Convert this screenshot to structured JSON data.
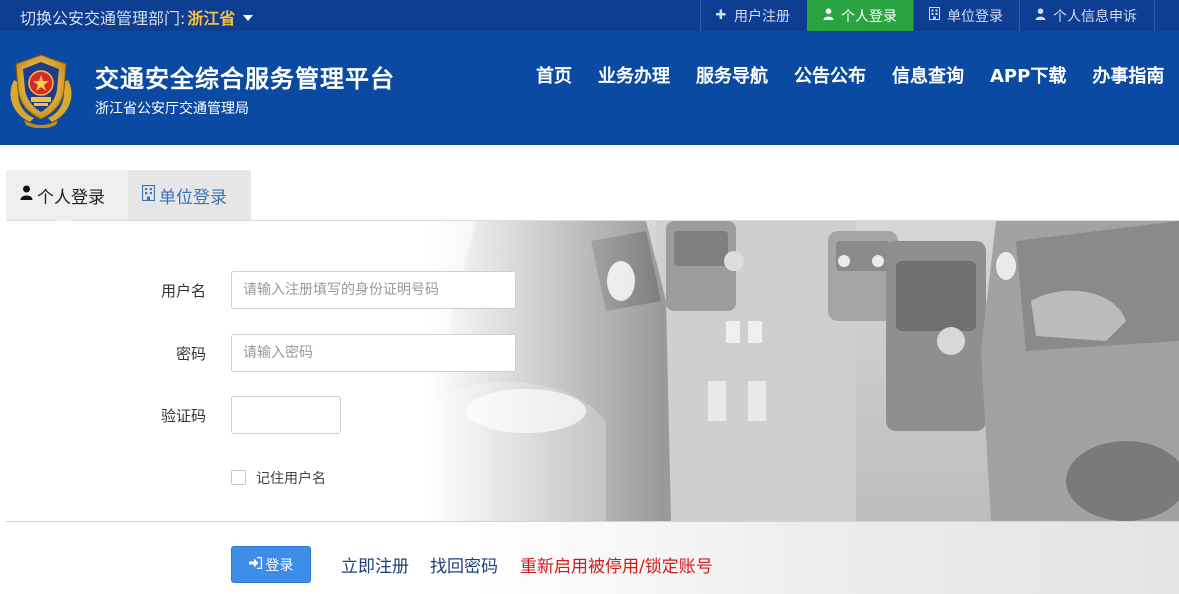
{
  "topbar": {
    "switch_label": "切换公安交通管理部门:",
    "province": "浙江省",
    "links": [
      {
        "icon": "plus-icon",
        "label": "用户注册",
        "active": false
      },
      {
        "icon": "user-icon",
        "label": "个人登录",
        "active": true
      },
      {
        "icon": "building-icon",
        "label": "单位登录",
        "active": false
      },
      {
        "icon": "user-icon",
        "label": "个人信息申诉",
        "active": false
      }
    ]
  },
  "header": {
    "title": "交通安全综合服务管理平台",
    "subtitle": "浙江省公安厅交通管理局",
    "emblem": "police-emblem-icon",
    "nav": [
      "首页",
      "业务办理",
      "服务导航",
      "公告公布",
      "信息查询",
      "APP下载",
      "办事指南"
    ]
  },
  "tabs": {
    "personal": {
      "icon": "user-icon",
      "label": "个人登录"
    },
    "unit": {
      "icon": "building-icon",
      "label": "单位登录"
    }
  },
  "form": {
    "username_label": "用户名",
    "username_placeholder": "请输入注册填写的身份证明号码",
    "username_value": "",
    "password_label": "密码",
    "password_placeholder": "请输入密码",
    "password_value": "",
    "captcha_label": "验证码",
    "captcha_value": "",
    "remember_label": "记住用户名",
    "remember_checked": false
  },
  "actions": {
    "login_icon": "sign-in-icon",
    "login_label": "登录",
    "register_link": "立即注册",
    "recover_link": "找回密码",
    "reactivate_link": "重新启用被停用/锁定账号"
  },
  "colors": {
    "topbar": "#0e3e92",
    "header": "#0b4aa2",
    "active_green": "#2aa343",
    "province_gold": "#f4c242",
    "login_button": "#3c8ce8",
    "warning_red": "#d11a1a"
  }
}
